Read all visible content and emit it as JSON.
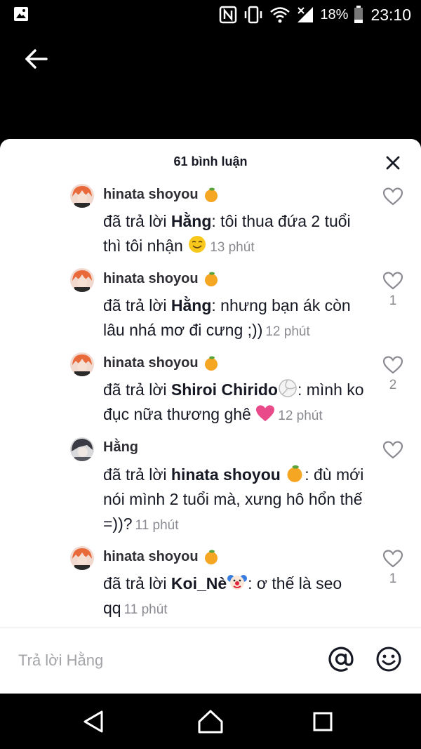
{
  "status_bar": {
    "battery": "18%",
    "time": "23:10"
  },
  "sheet": {
    "title": "61 bình luận"
  },
  "comments": [
    {
      "username": "hinata shoyou",
      "reply_prefix": "đã trả lời ",
      "reply_to": "Hằng",
      "body": ": tôi thua đứa 2 tuổi thì tôi nhận ",
      "time": "13 phút",
      "likes": ""
    },
    {
      "username": "hinata shoyou",
      "reply_prefix": "đã trả lời ",
      "reply_to": "Hằng",
      "body": ": nhưng bạn ák còn lâu nhá mơ đi cưng ;))",
      "time": "12 phút",
      "likes": "1"
    },
    {
      "username": "hinata shoyou",
      "reply_prefix": "đã trả lời ",
      "reply_to": "Shiroi Chirido",
      "body": ": mình ko đục nữa thương ghê ",
      "time": "12 phút",
      "likes": "2"
    },
    {
      "username": "Hằng",
      "reply_prefix": "đã trả lời ",
      "reply_to": "hinata shoyou",
      "body": ": đù mới nói mình 2 tuổi mà, xưng hô hổn thế =))?",
      "time": "11 phút",
      "likes": ""
    },
    {
      "username": "hinata shoyou",
      "reply_prefix": "đã trả lời ",
      "reply_to": "Koi_Nè",
      "body": ": ơ thế là seo qq",
      "time": "11 phút",
      "likes": "1"
    }
  ],
  "reply_bar": {
    "placeholder": "Trả lời Hằng"
  },
  "icons": {
    "tangerine": "tangerine-emoji",
    "smile": "smiling-face-emoji",
    "volleyball": "volleyball-emoji",
    "heart": "pink-heart-emoji",
    "clown": "clown-emoji"
  },
  "colors": {
    "accent_orange": "#f5a623",
    "pink_heart": "#e84a8a",
    "time_gray": "#8a8b91"
  }
}
